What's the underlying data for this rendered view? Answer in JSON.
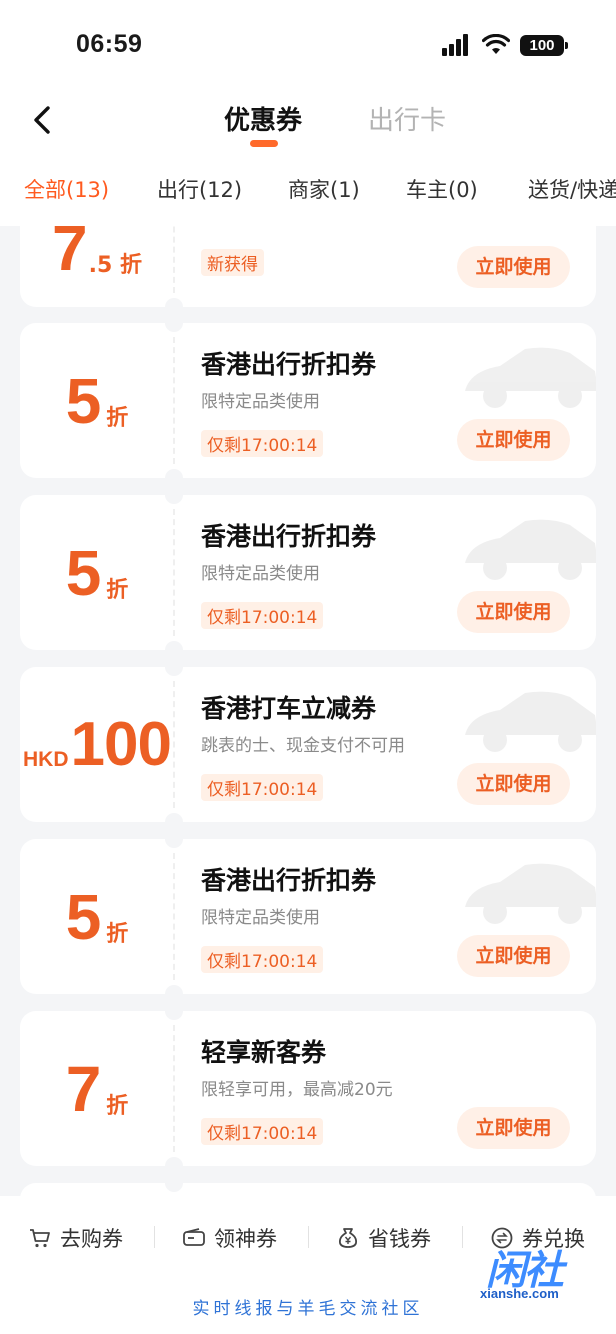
{
  "status_bar": {
    "time": "06:59",
    "battery": "100"
  },
  "nav": {
    "tabs": [
      "优惠券",
      "出行卡"
    ]
  },
  "filters": [
    "全部(13)",
    "出行(12)",
    "商家(1)",
    "车主(0)",
    "送货/快递"
  ],
  "coupons": [
    {
      "num": "7",
      "unit": ".5 折",
      "prefix": "",
      "title": "",
      "subtitle": "",
      "tag": "新获得",
      "button": "立即使用"
    },
    {
      "num": "5",
      "unit": "折",
      "prefix": "",
      "title": "香港出行折扣券",
      "subtitle": "限特定品类使用",
      "tag": "仅剩17:00:14",
      "button": "立即使用"
    },
    {
      "num": "5",
      "unit": "折",
      "prefix": "",
      "title": "香港出行折扣券",
      "subtitle": "限特定品类使用",
      "tag": "仅剩17:00:14",
      "button": "立即使用"
    },
    {
      "num": "100",
      "unit": "",
      "prefix": "HKD",
      "title": "香港打车立减券",
      "subtitle": "跳表的士、现金支付不可用",
      "tag": "仅剩17:00:14",
      "button": "立即使用"
    },
    {
      "num": "5",
      "unit": "折",
      "prefix": "",
      "title": "香港出行折扣券",
      "subtitle": "限特定品类使用",
      "tag": "仅剩17:00:14",
      "button": "立即使用"
    },
    {
      "num": "7",
      "unit": "折",
      "prefix": "",
      "title": "轻享新客券",
      "subtitle": "限轻享可用，最高减20元",
      "tag": "仅剩17:00:14",
      "button": "立即使用"
    }
  ],
  "bottom_nav": [
    {
      "label": "去购券",
      "icon": "cart-icon"
    },
    {
      "label": "领神券",
      "icon": "ticket-icon"
    },
    {
      "label": "省钱券",
      "icon": "money-bag-icon"
    },
    {
      "label": "券兑换",
      "icon": "exchange-icon"
    }
  ],
  "slogan": "实时线报与羊毛交流社区",
  "watermark": {
    "logo": "闲社",
    "url": "xianshe.com"
  },
  "colors": {
    "accent": "#ec5f24",
    "tab_indicator": "#ff6a2b",
    "button_bg": "#fff0e7",
    "slogan": "#2f73d6"
  }
}
